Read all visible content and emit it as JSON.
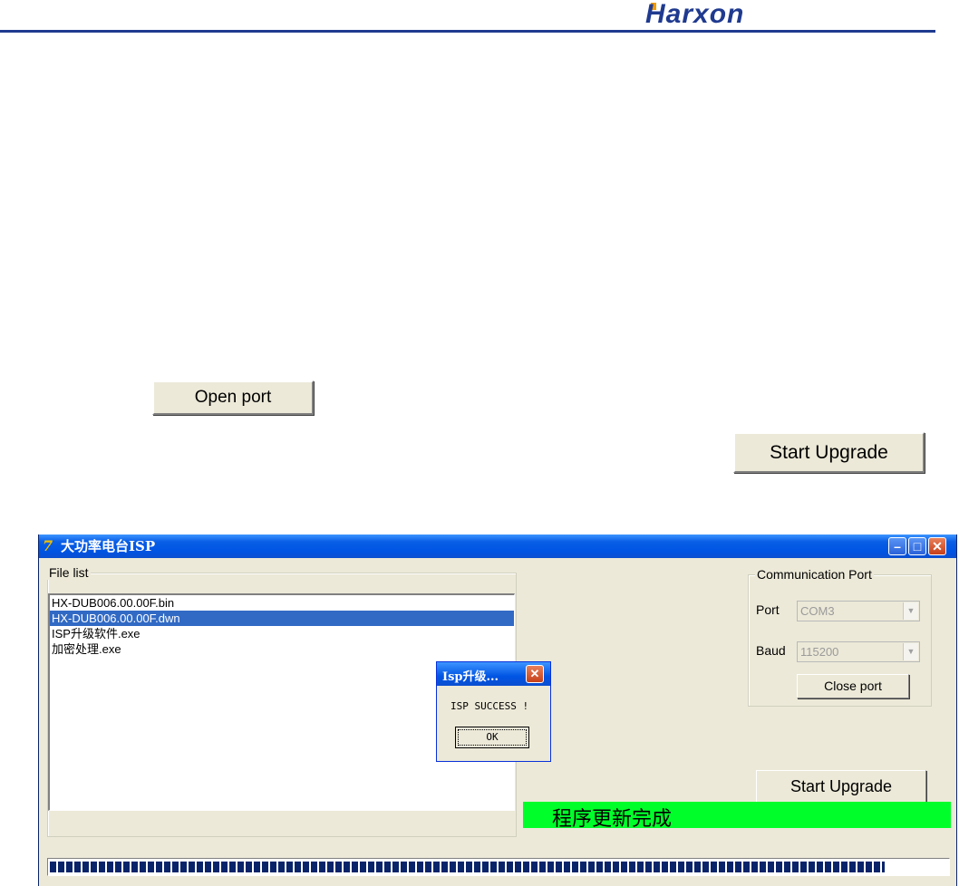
{
  "header": {
    "logo_text": "Harxon",
    "brand_color": "#1f3a8f"
  },
  "doc_buttons": {
    "open_port": "Open port",
    "start_upgrade": "Start Upgrade"
  },
  "window": {
    "title": "大功率电台ISP",
    "app_icon": "app-logo-icon",
    "controls": {
      "minimize": "minimize-icon",
      "maximize": "maximize-icon",
      "close": "close-icon"
    },
    "file_list": {
      "label": "File list",
      "items": [
        {
          "name": "HX-DUB006.00.00F.bin",
          "selected": false
        },
        {
          "name": "HX-DUB006.00.00F.dwn",
          "selected": true
        },
        {
          "name": "ISP升级软件.exe",
          "selected": false
        },
        {
          "name": "加密处理.exe",
          "selected": false
        }
      ]
    },
    "comm_port": {
      "label": "Communication Port",
      "port_label": "Port",
      "port_value": "COM3",
      "baud_label": "Baud",
      "baud_value": "115200",
      "close_port": "Close port"
    },
    "start_upgrade": "Start Upgrade",
    "status_text": "程序更新完成",
    "status_color": "#00ff2a",
    "progress_fraction": 0.93
  },
  "message_box": {
    "title": "Isp升级...",
    "message": "ISP SUCCESS !",
    "ok": "OK"
  }
}
